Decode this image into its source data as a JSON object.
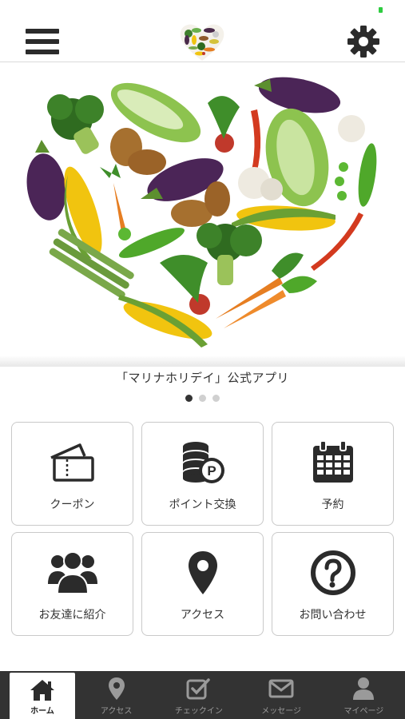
{
  "header": {
    "menu_icon": "hamburger-icon",
    "logo_icon": "vegetable-heart-logo",
    "settings_icon": "gear-icon"
  },
  "hero": {
    "caption": "「マリナホリデイ」公式アプリ",
    "slide_count": 3,
    "active_slide": 1
  },
  "menu": [
    {
      "label": "クーポン",
      "icon": "coupon-ticket-icon"
    },
    {
      "label": "ポイント交換",
      "icon": "points-coins-icon"
    },
    {
      "label": "予約",
      "icon": "calendar-icon"
    },
    {
      "label": "お友達に紹介",
      "icon": "group-users-icon"
    },
    {
      "label": "アクセス",
      "icon": "map-pin-icon"
    },
    {
      "label": "お問い合わせ",
      "icon": "question-icon"
    }
  ],
  "tabs": [
    {
      "label": "ホーム",
      "icon": "home-icon",
      "active": true
    },
    {
      "label": "アクセス",
      "icon": "map-pin-icon"
    },
    {
      "label": "チェックイン",
      "icon": "checkin-icon"
    },
    {
      "label": "メッセージ",
      "icon": "envelope-icon"
    },
    {
      "label": "マイページ",
      "icon": "user-icon"
    }
  ],
  "colors": {
    "icon_dark": "#2b2b2b",
    "tabbar_bg": "#333333",
    "tab_inactive": "#9a9a9a"
  }
}
